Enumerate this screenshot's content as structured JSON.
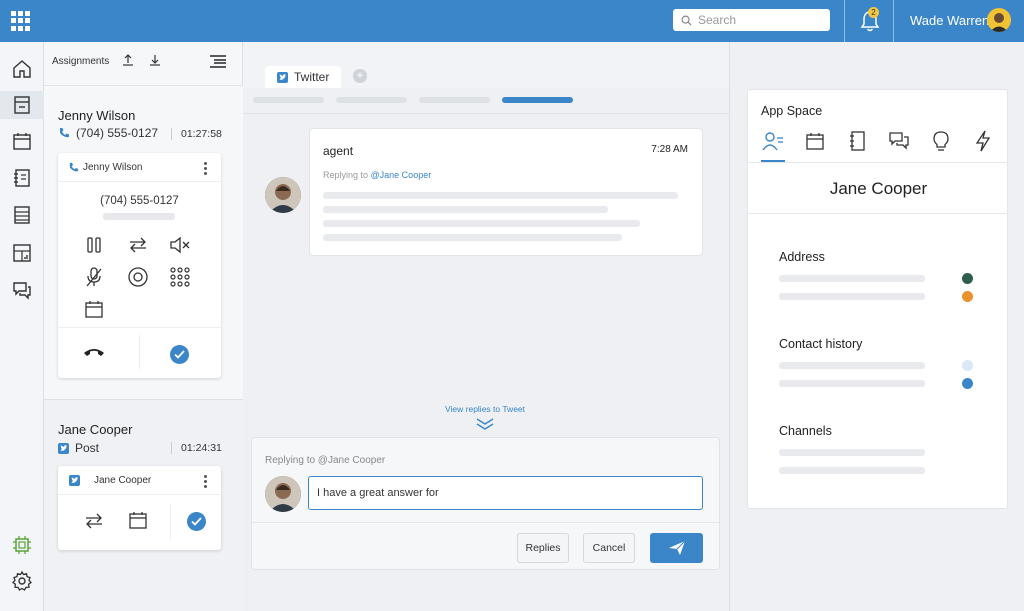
{
  "header": {
    "search_placeholder": "Search",
    "notification_count": "2",
    "user_name": "Wade Warren"
  },
  "rail": {
    "items": [
      "home-icon",
      "inbox-icon",
      "calendar-icon",
      "notebook-icon",
      "list-icon",
      "report-icon",
      "chat-icon",
      "chip-icon",
      "gear-icon"
    ]
  },
  "assignments": {
    "title": "Assignments",
    "contacts": [
      {
        "name": "Jenny Wilson",
        "sub": "(704) 555-0127",
        "time": "01:27:58",
        "card_title": "Jenny Wilson",
        "card_number": "(704) 555-0127"
      },
      {
        "name": "Jane Cooper",
        "sub": "Post",
        "time": "01:24:31",
        "card_title": "Jane Cooper"
      }
    ]
  },
  "center": {
    "tab_label": "Twitter",
    "tweet": {
      "author": "agent",
      "time": "7:28 AM",
      "replying_prefix": "Replying to ",
      "replying_handle": "@Jane Cooper"
    },
    "view_replies": "View replies to Tweet",
    "reply": {
      "label": "Replying to @Jane Cooper",
      "value": "I have a great answer for",
      "replies_btn": "Replies",
      "cancel_btn": "Cancel"
    }
  },
  "app_space": {
    "title": "App Space",
    "contact_name": "Jane Cooper",
    "sections": [
      "Address",
      "Contact history",
      "Channels"
    ],
    "dot_colors": {
      "address_1": "#2f5d50",
      "address_2": "#e8912d",
      "history_1": "#dbe9f6",
      "history_2": "#3a86c8"
    }
  },
  "colors": {
    "brand": "#3a86c8"
  }
}
